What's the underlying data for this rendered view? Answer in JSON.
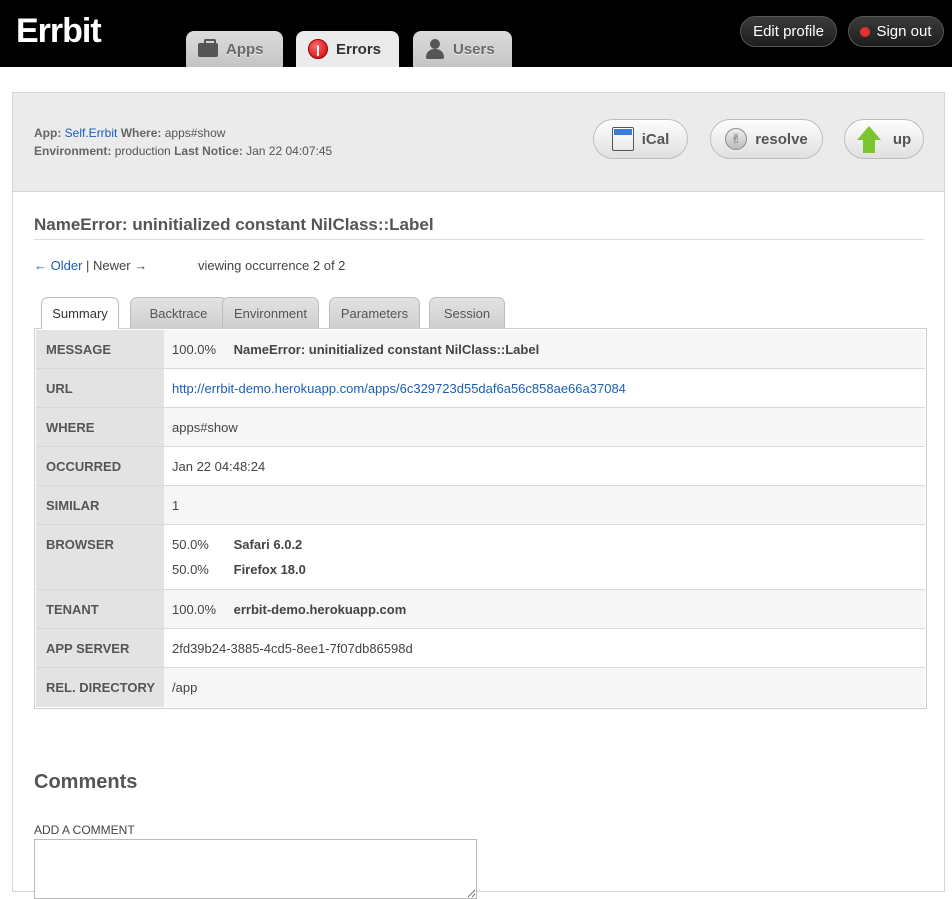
{
  "header": {
    "logo": "Errbit",
    "nav": [
      {
        "label": "Apps",
        "icon": "briefcase-icon"
      },
      {
        "label": "Errors",
        "icon": "error-icon",
        "active": true
      },
      {
        "label": "Users",
        "icon": "user-icon"
      }
    ],
    "edit_profile": "Edit profile",
    "sign_out": "Sign out"
  },
  "meta": {
    "app_label": "App:",
    "app_value": "Self.Errbit",
    "where_label": "Where:",
    "where_value": "apps#show",
    "env_label": "Environment:",
    "env_value": "production",
    "last_notice_label": "Last Notice:",
    "last_notice_value": "Jan 22 04:07:45"
  },
  "actions": {
    "ical": "iCal",
    "resolve": "resolve",
    "up": "up"
  },
  "error_title": "NameError: uninitialized constant NilClass::Label",
  "pager": {
    "older": "← Older",
    "separator": "|",
    "newer": "Newer →",
    "occurrence": "viewing occurrence 2 of 2"
  },
  "tabs": [
    "Summary",
    "Backtrace",
    "Environment",
    "Parameters",
    "Session"
  ],
  "summary": {
    "message_label": "MESSAGE",
    "message_pct": "100.0%",
    "message_text": "NameError: uninitialized constant NilClass::Label",
    "url_label": "URL",
    "url_value": "http://errbit-demo.herokuapp.com/apps/6c329723d55daf6a56c858ae66a37084",
    "where_label": "WHERE",
    "where_value": "apps#show",
    "occurred_label": "OCCURRED",
    "occurred_value": "Jan 22 04:48:24",
    "similar_label": "SIMILAR",
    "similar_value": "1",
    "browser_label": "BROWSER",
    "browsers": [
      {
        "pct": "50.0%",
        "name": "Safari 6.0.2"
      },
      {
        "pct": "50.0%",
        "name": "Firefox 18.0"
      }
    ],
    "tenant_label": "TENANT",
    "tenant_pct": "100.0%",
    "tenant_value": "errbit-demo.herokuapp.com",
    "app_server_label": "APP SERVER",
    "app_server_value": "2fd39b24-3885-4cd5-8ee1-7f07db86598d",
    "rel_dir_label": "REL. DIRECTORY",
    "rel_dir_value": "/app"
  },
  "comments": {
    "heading": "Comments",
    "add_label": "ADD A COMMENT"
  }
}
